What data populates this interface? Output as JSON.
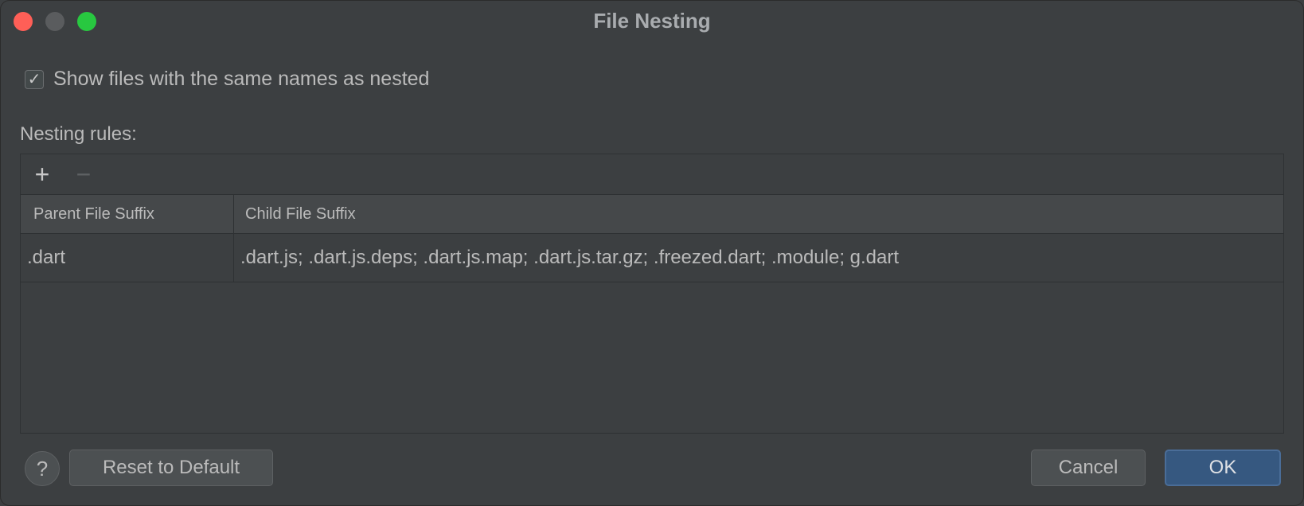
{
  "window": {
    "title": "File Nesting"
  },
  "options": {
    "show_same_names_checked": true,
    "show_same_names_label": "Show files with the same names as nested"
  },
  "rules": {
    "section_label": "Nesting rules:",
    "toolbar": {
      "add_glyph": "+",
      "remove_glyph": "−"
    },
    "columns": [
      "Parent File Suffix",
      "Child File Suffix"
    ],
    "rows": [
      {
        "parent": ".dart",
        "child": ".dart.js; .dart.js.deps; .dart.js.map; .dart.js.tar.gz; .freezed.dart; .module; g.dart"
      }
    ]
  },
  "footer": {
    "help_glyph": "?",
    "reset_label": "Reset to Default",
    "cancel_label": "Cancel",
    "ok_label": "OK"
  },
  "colors": {
    "background": "#3c3f41",
    "text": "#bbbbbb",
    "accent_button": "#365880",
    "close": "#ff5f57",
    "zoom": "#28c840"
  },
  "icons": {
    "checkbox": "checkmark-icon",
    "add": "plus-icon",
    "remove": "minus-icon",
    "help": "question-mark-icon"
  }
}
